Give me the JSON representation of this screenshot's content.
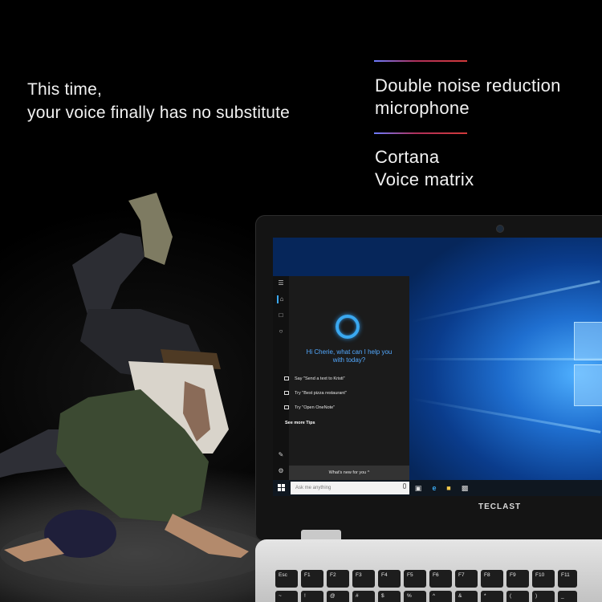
{
  "headline": {
    "line1": "This time,",
    "line2": "your voice finally has no substitute"
  },
  "features": [
    {
      "line1": "Double noise reduction",
      "line2": "microphone"
    },
    {
      "line1": "Cortana",
      "line2": "Voice matrix"
    }
  ],
  "colors": {
    "background": "#000000",
    "text": "#f2f2f2",
    "rule_start": "#6d7cff",
    "rule_end": "#d23a3a",
    "cortana_blue": "#3aa8f0",
    "desktop_blue": "#1f6fd0"
  },
  "cortana": {
    "greeting_line1": "Hi Cherie, what can I help you",
    "greeting_line2": "with today?",
    "tips": [
      "Say \"Send a text to Kristi\"",
      "Try \"Best pizza restaurant\"",
      "Try \"Open OneNote\""
    ],
    "see_more": "See more Tips",
    "whats_new": "What's new for you  ^",
    "rail_icons": [
      "hamburger-icon",
      "home-icon",
      "notebook-icon",
      "lightbulb-icon",
      "feedback-icon",
      "settings-icon"
    ]
  },
  "taskbar": {
    "search_placeholder": "Ask me anything",
    "icons": [
      "windows-start-icon",
      "microphone-icon",
      "task-view-icon",
      "edge-icon",
      "file-explorer-icon",
      "store-icon"
    ]
  },
  "brand": "TECLAST",
  "keyboard": {
    "row1": [
      "Esc",
      "F1",
      "F2",
      "F3",
      "F4",
      "F5",
      "F6",
      "F7",
      "F8",
      "F9",
      "F10",
      "F11"
    ],
    "row2": [
      "~",
      "!",
      "@",
      "#",
      "$",
      "%",
      "^",
      "&",
      "*",
      "(",
      ")",
      "_"
    ]
  }
}
